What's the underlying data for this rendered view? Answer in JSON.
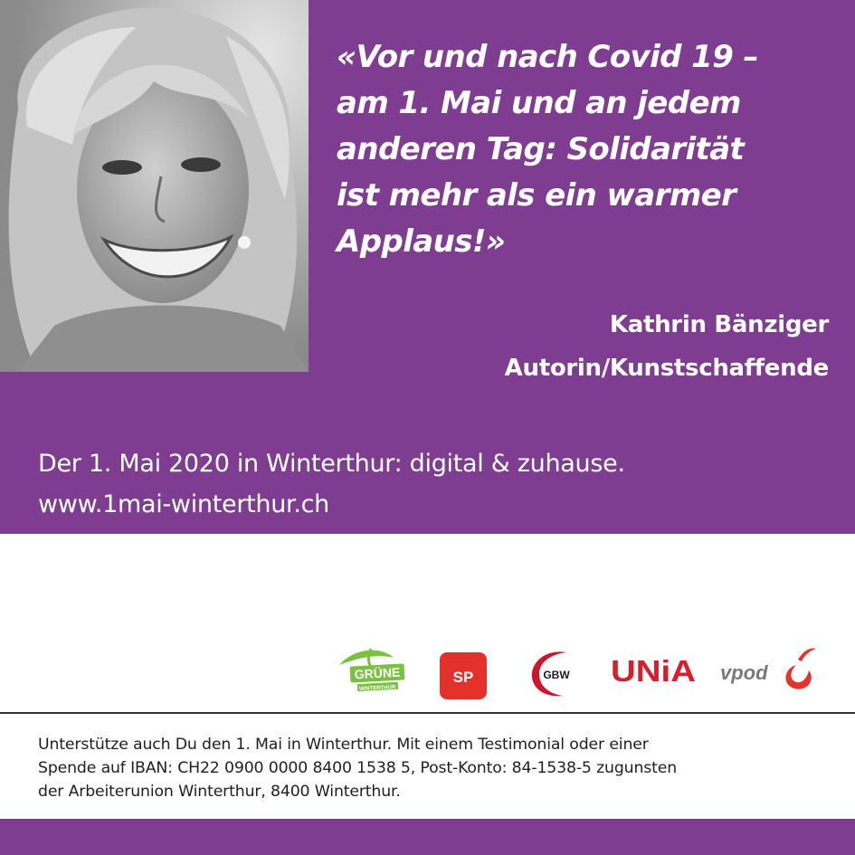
{
  "colors": {
    "brand_purple": "#7f3d91",
    "text_on_purple": "#ffffff",
    "body_text": "#1f1f1f",
    "gruene_green": "#7ac142",
    "sp_red": "#e4312b",
    "unia_red": "#d81e2c",
    "gbw_red": "#d0142c",
    "vpod_red": "#e3352c"
  },
  "photo": {
    "description_icon": "portrait-photo"
  },
  "quote": {
    "lines": [
      "«Vor und nach Covid 19 –",
      "am 1. Mai und an jedem",
      "anderen Tag: Solidarität",
      "ist mehr als ein warmer",
      "Applaus!»"
    ]
  },
  "author": {
    "name": "Kathrin Bänziger",
    "role": "Autorin/Kunstschaffende"
  },
  "event": {
    "line": "Der 1. Mai 2020 in Winterthur: digital & zuhause.",
    "url": "www.1mai-winterthur.ch"
  },
  "logos": {
    "gruene": {
      "text": "GRÜNE",
      "subtext": "WINTERTHUR"
    },
    "sp": {
      "text": "SP"
    },
    "gbw": {
      "text": "GBW"
    },
    "unia": {
      "text": "UNiA"
    },
    "vpod": {
      "text": "vpod"
    }
  },
  "donation": {
    "lines": [
      "Unterstütze auch Du den 1. Mai in Winterthur. Mit einem Testimonial oder einer",
      "Spende auf IBAN: CH22 0900 0000 8400 1538 5, Post-Konto: 84-1538-5 zugunsten",
      "der Arbeiterunion Winterthur, 8400 Winterthur."
    ]
  }
}
